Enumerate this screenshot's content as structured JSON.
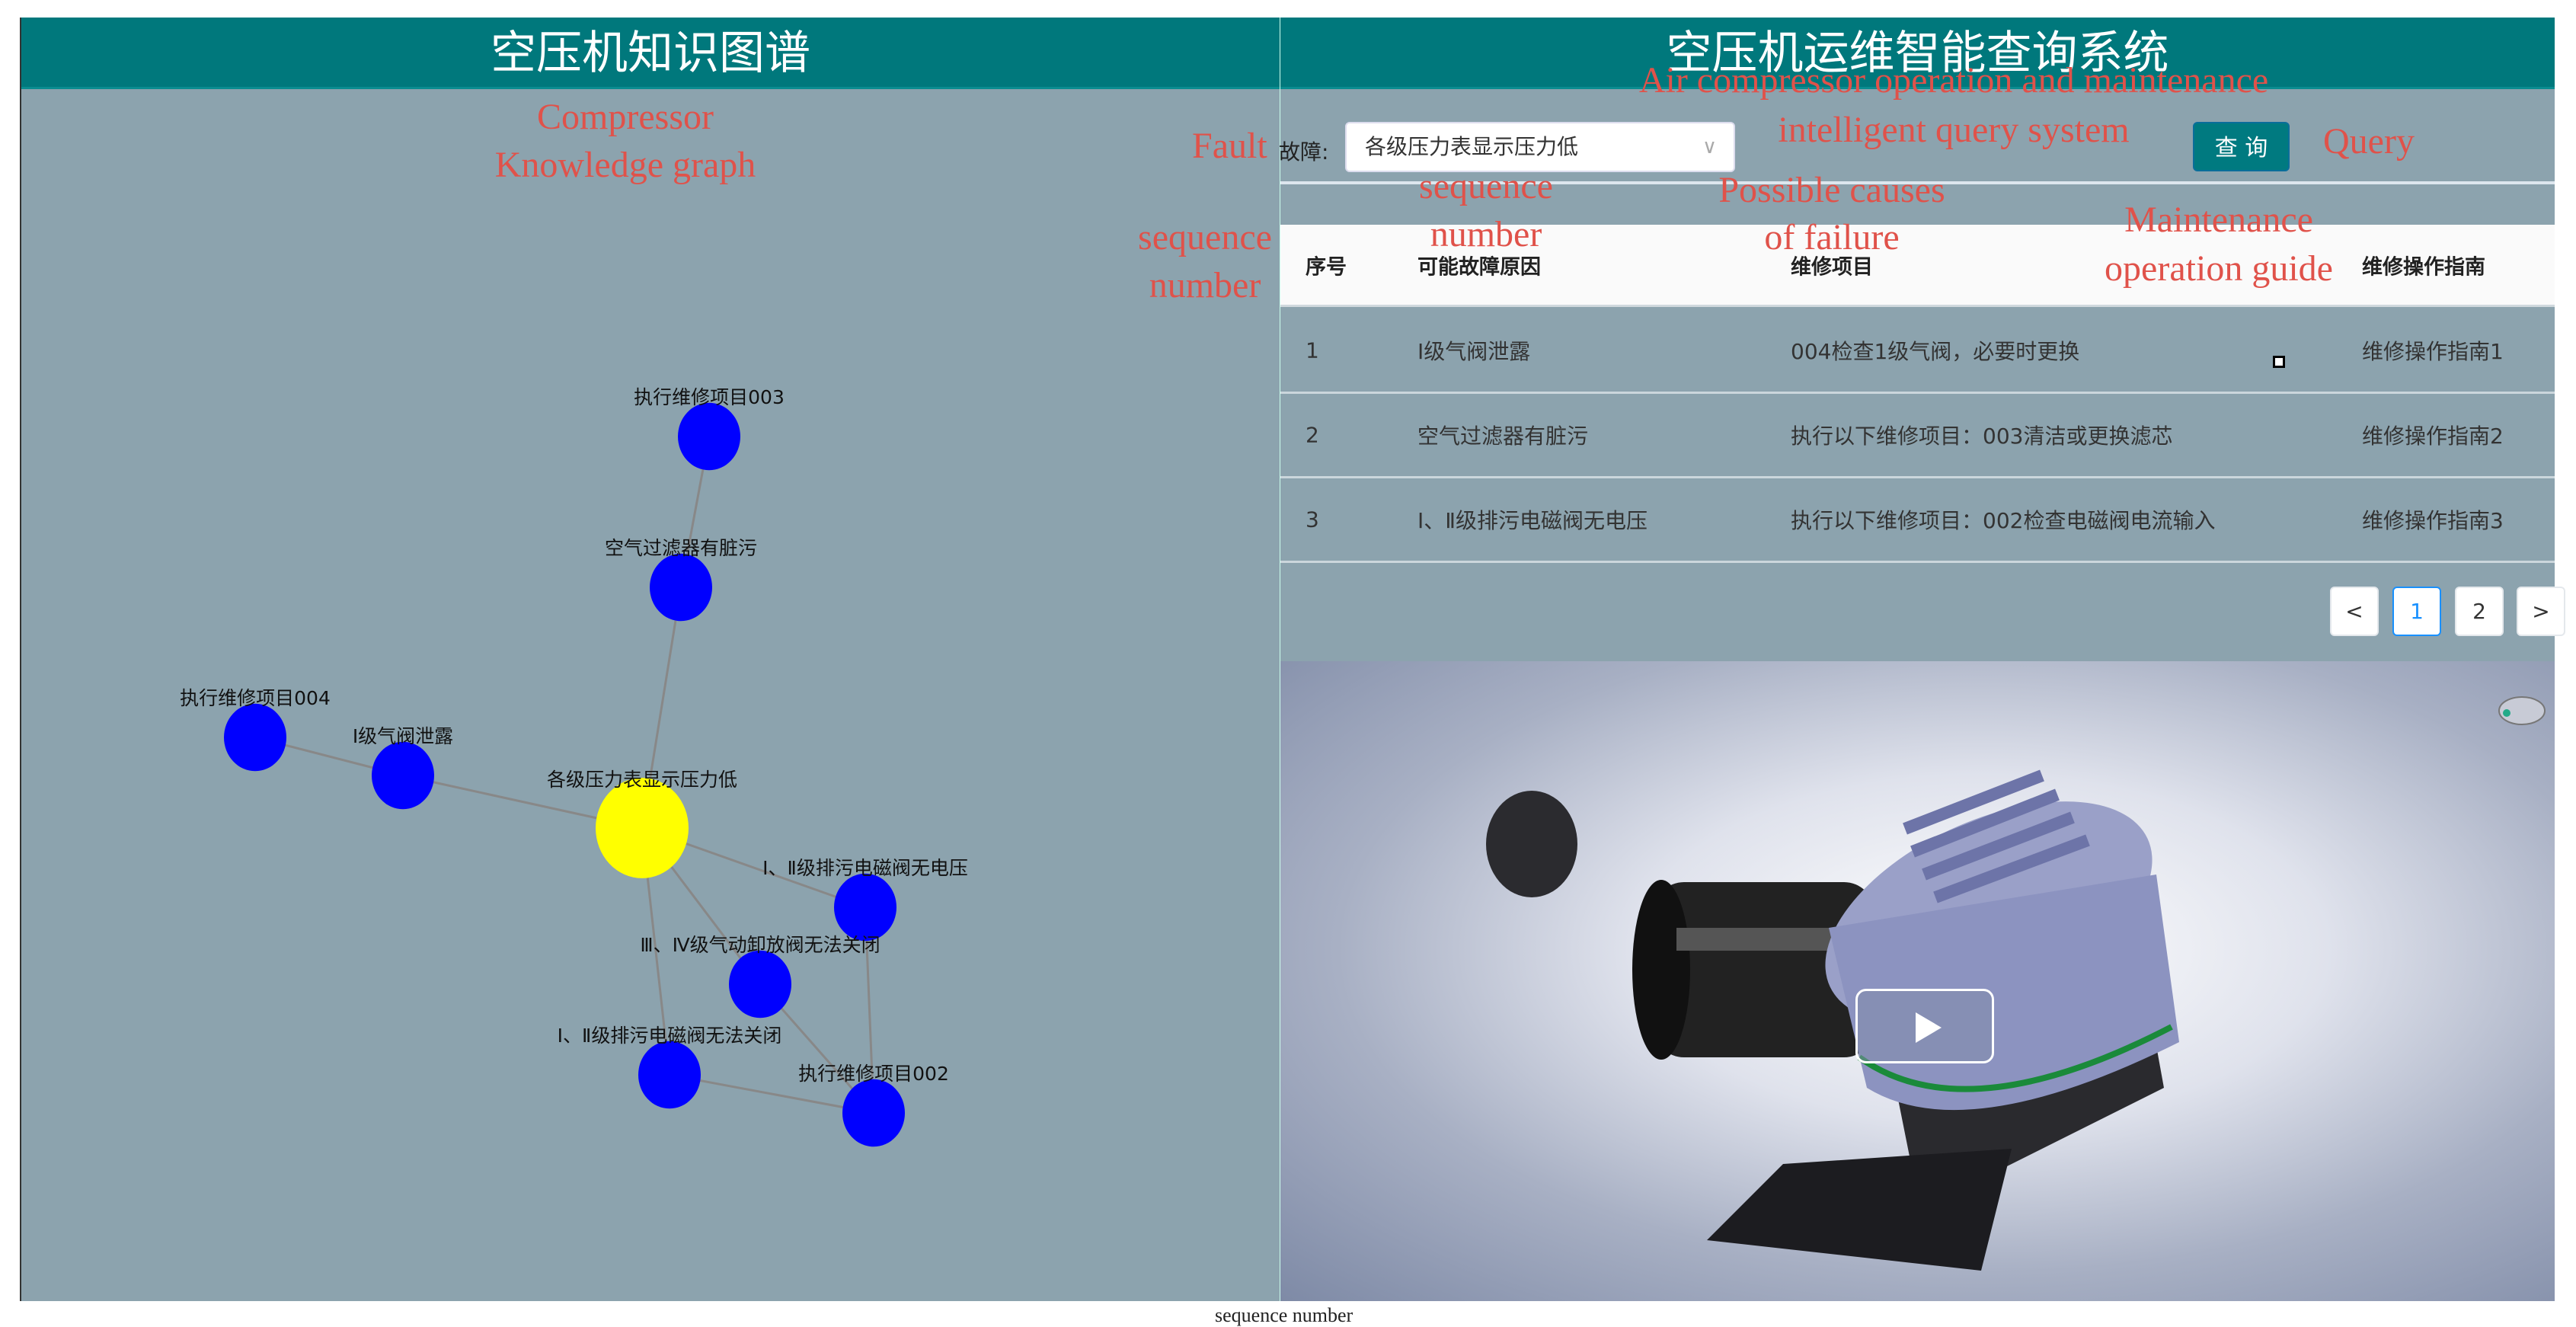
{
  "left_panel": {
    "title": "空压机知识图谱"
  },
  "graph": {
    "center": {
      "label": "各级压力表显示压力低",
      "color": "#ffff00"
    },
    "node_color": "#0000ff",
    "nodes": [
      {
        "id": "n003",
        "label": "执行维修项目003"
      },
      {
        "id": "filter",
        "label": "空气过滤器有脏污"
      },
      {
        "id": "n004",
        "label": "执行维修项目004"
      },
      {
        "id": "valve1",
        "label": "Ⅰ级气阀泄露"
      },
      {
        "id": "drain_nov",
        "label": "Ⅰ、Ⅱ级排污电磁阀无电压"
      },
      {
        "id": "unload",
        "label": "Ⅲ、Ⅳ级气动卸放阀无法关闭"
      },
      {
        "id": "drain_close",
        "label": "Ⅰ、Ⅱ级排污电磁阀无法关闭"
      },
      {
        "id": "n002",
        "label": "执行维修项目002"
      }
    ],
    "links": [
      [
        "n003",
        "filter"
      ],
      [
        "filter",
        "center"
      ],
      [
        "n004",
        "valve1"
      ],
      [
        "valve1",
        "center"
      ],
      [
        "center",
        "drain_nov"
      ],
      [
        "center",
        "unload"
      ],
      [
        "center",
        "drain_close"
      ],
      [
        "drain_nov",
        "n002"
      ],
      [
        "unload",
        "n002"
      ],
      [
        "drain_close",
        "n002"
      ]
    ]
  },
  "right_panel": {
    "title": "空压机运维智能查询系统",
    "fault_label": "故障:",
    "fault_value": "各级压力表显示压力低",
    "query_button": "查 询",
    "table": {
      "headers": [
        "序号",
        "可能故障原因",
        "维修项目",
        "维修操作指南"
      ],
      "rows": [
        [
          "1",
          "Ⅰ级气阀泄露",
          "004检查1级气阀，必要时更换",
          "维修操作指南1"
        ],
        [
          "2",
          "空气过滤器有脏污",
          "执行以下维修项目：003清洁或更换滤芯",
          "维修操作指南2"
        ],
        [
          "3",
          "Ⅰ、Ⅱ级排污电磁阀无电压",
          "执行以下维修项目：002检查电磁阀电流输入",
          "维修操作指南3"
        ]
      ]
    },
    "pagination": {
      "prev": "<",
      "pages": [
        "1",
        "2"
      ],
      "current": "1",
      "next": ">"
    }
  },
  "annotations": {
    "compressor": "Compressor",
    "knowledge_graph": "Knowledge graph",
    "title_en_1": "Air compressor operation and maintenance",
    "title_en_2": "intelligent query system",
    "fault": "Fault",
    "query": "Query",
    "seq_1": "sequence",
    "seq_2": "number",
    "causes_1": "Possible causes",
    "causes_2": "of failure",
    "guide_1": "Maintenance",
    "guide_2": "operation guide",
    "left_seq_1": "sequence",
    "left_seq_2": "number",
    "bottom": "sequence number"
  }
}
